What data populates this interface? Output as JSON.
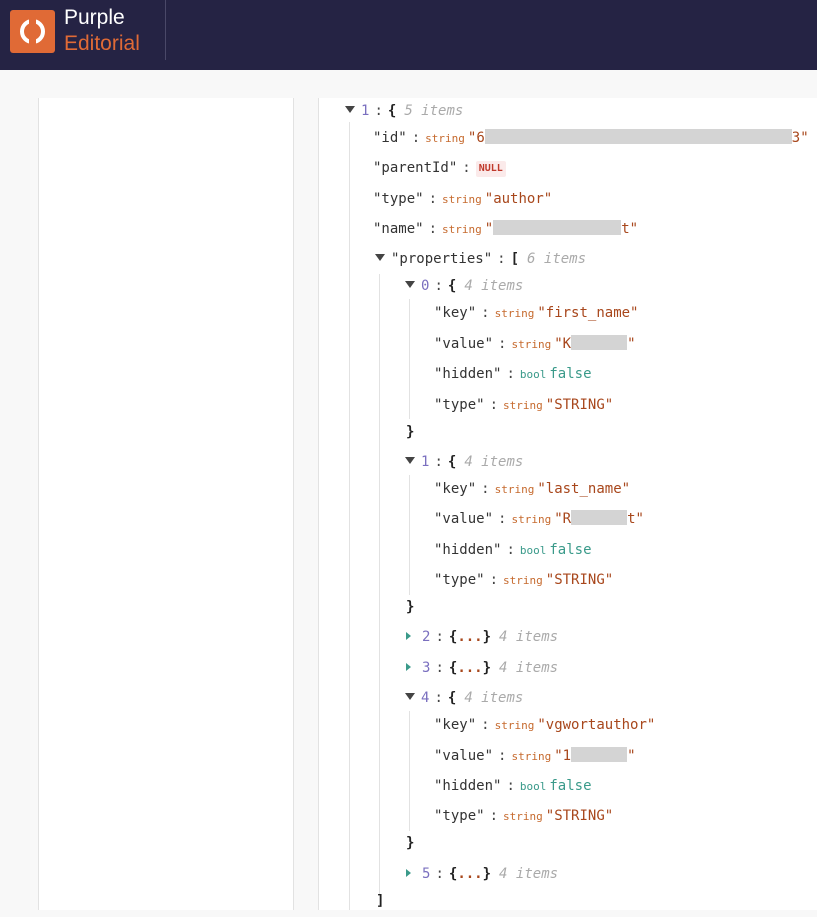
{
  "app": {
    "brand_line1": "Purple",
    "brand_line2": "Editorial",
    "brand_color": "#e06a36",
    "header_bg": "#252344"
  },
  "viewer": {
    "root": {
      "index": "1",
      "open": "{",
      "count": "5 items"
    },
    "fields": {
      "id": {
        "key": "\"id\"",
        "type": "string",
        "q_open": "\"6",
        "q_close": "3\""
      },
      "parentId": {
        "key": "\"parentId\"",
        "value": "NULL"
      },
      "type": {
        "key": "\"type\"",
        "type": "string",
        "value": "\"author\""
      },
      "name": {
        "key": "\"name\"",
        "type": "string",
        "q_open": "\"",
        "q_close": "t\""
      }
    },
    "properties": {
      "key": "\"properties\"",
      "open": "[",
      "count": "6 items",
      "close": "]"
    },
    "items": {
      "i0": {
        "index": "0",
        "open": "{",
        "count": "4 items",
        "close": "}",
        "key_k": "\"key\"",
        "key_t": "string",
        "key_v": "\"first_name\"",
        "value_k": "\"value\"",
        "value_t": "string",
        "value_open": "\"K",
        "value_close": "\"",
        "hidden_k": "\"hidden\"",
        "hidden_t": "bool",
        "hidden_v": "false",
        "type_k": "\"type\"",
        "type_t": "string",
        "type_v": "\"STRING\""
      },
      "i1": {
        "index": "1",
        "open": "{",
        "count": "4 items",
        "close": "}",
        "key_k": "\"key\"",
        "key_t": "string",
        "key_v": "\"last_name\"",
        "value_k": "\"value\"",
        "value_t": "string",
        "value_open": "\"R",
        "value_close": "t\"",
        "hidden_k": "\"hidden\"",
        "hidden_t": "bool",
        "hidden_v": "false",
        "type_k": "\"type\"",
        "type_t": "string",
        "type_v": "\"STRING\""
      },
      "i2": {
        "index": "2",
        "open": "{",
        "dots": "...",
        "close": "}",
        "count": "4 items"
      },
      "i3": {
        "index": "3",
        "open": "{",
        "dots": "...",
        "close": "}",
        "count": "4 items"
      },
      "i4": {
        "index": "4",
        "open": "{",
        "count": "4 items",
        "close": "}",
        "key_k": "\"key\"",
        "key_t": "string",
        "key_v": "\"vgwortauthor\"",
        "value_k": "\"value\"",
        "value_t": "string",
        "value_open": "\"1",
        "value_close": "\"",
        "hidden_k": "\"hidden\"",
        "hidden_t": "bool",
        "hidden_v": "false",
        "type_k": "\"type\"",
        "type_t": "string",
        "type_v": "\"STRING\""
      },
      "i5": {
        "index": "5",
        "open": "{",
        "dots": "...",
        "close": "}",
        "count": "4 items"
      }
    },
    "colon": ":"
  }
}
